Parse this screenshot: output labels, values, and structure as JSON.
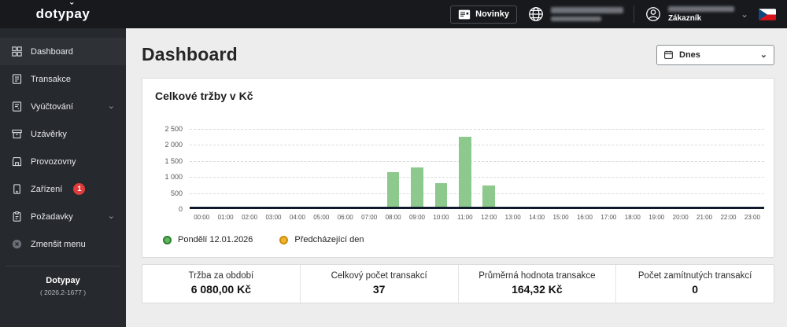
{
  "topbar": {
    "logo": "dotypay",
    "logo_accent": "ˇ",
    "novinky_label": "Novinky",
    "user_role": "Zákazník"
  },
  "sidebar": {
    "items": [
      {
        "id": "dashboard",
        "icon": "dashboard",
        "label": "Dashboard",
        "active": true
      },
      {
        "id": "transakce",
        "icon": "transactions",
        "label": "Transakce"
      },
      {
        "id": "vyuctovani",
        "icon": "billing",
        "label": "Vyúčtování",
        "expandable": true
      },
      {
        "id": "uzaverky",
        "icon": "closures",
        "label": "Uzávěrky"
      },
      {
        "id": "provozovny",
        "icon": "stores",
        "label": "Provozovny"
      },
      {
        "id": "zarizeni",
        "icon": "devices",
        "label": "Zařízení",
        "badge": "1"
      },
      {
        "id": "pozadavky",
        "icon": "requests",
        "label": "Požadavky",
        "expandable": true
      },
      {
        "id": "zmensit-menu",
        "icon": "collapse",
        "label": "Zmenšit menu"
      }
    ],
    "footer_brand": "Dotypay",
    "footer_version": "( 2026.2-1677 )"
  },
  "main": {
    "page_title": "Dashboard",
    "date_filter": "Dnes",
    "card_title": "Celkové tržby v Kč",
    "legend": [
      {
        "label": "Pondělí 12.01.2026",
        "color": "#5cb85c",
        "ring": "#2e7d32"
      },
      {
        "label": "Předcházející den",
        "color": "#f2b331",
        "ring": "#c98f0a"
      }
    ],
    "stats": [
      {
        "label": "Tržba za období",
        "value": "6 080,00 Kč"
      },
      {
        "label": "Celkový počet transakcí",
        "value": "37"
      },
      {
        "label": "Průměrná hodnota transakce",
        "value": "164,32 Kč"
      },
      {
        "label": "Počet zamítnutých transakcí",
        "value": "0"
      }
    ]
  },
  "chart_data": {
    "type": "bar",
    "title": "Celkové tržby v Kč",
    "categories": [
      "00:00",
      "01:00",
      "02:00",
      "03:00",
      "04:00",
      "05:00",
      "06:00",
      "07:00",
      "08:00",
      "09:00",
      "10:00",
      "11:00",
      "12:00",
      "13:00",
      "14:00",
      "15:00",
      "16:00",
      "17:00",
      "18:00",
      "19:00",
      "20:00",
      "21:00",
      "22:00",
      "23:00"
    ],
    "series": [
      {
        "name": "Pondělí 12.01.2026",
        "color": "#8dc88d",
        "values": [
          0,
          0,
          0,
          0,
          0,
          0,
          0,
          0,
          1120,
          1270,
          760,
          2250,
          680,
          0,
          0,
          0,
          0,
          0,
          0,
          0,
          0,
          0,
          0,
          0
        ]
      },
      {
        "name": "Předcházející den",
        "color": "#f2b331",
        "values": [
          0,
          0,
          0,
          0,
          0,
          0,
          0,
          0,
          0,
          0,
          0,
          0,
          0,
          0,
          0,
          0,
          0,
          0,
          0,
          0,
          0,
          0,
          0,
          0
        ]
      }
    ],
    "ylim": [
      0,
      2500
    ],
    "yticks": [
      0,
      500,
      1000,
      1500,
      2000,
      2500
    ],
    "ytick_labels": [
      "0",
      "500",
      "1 000",
      "1 500",
      "2 000",
      "2 500"
    ],
    "grid": "dashed-horizontal",
    "legend_position": "bottom",
    "xlabel": "",
    "ylabel": ""
  }
}
